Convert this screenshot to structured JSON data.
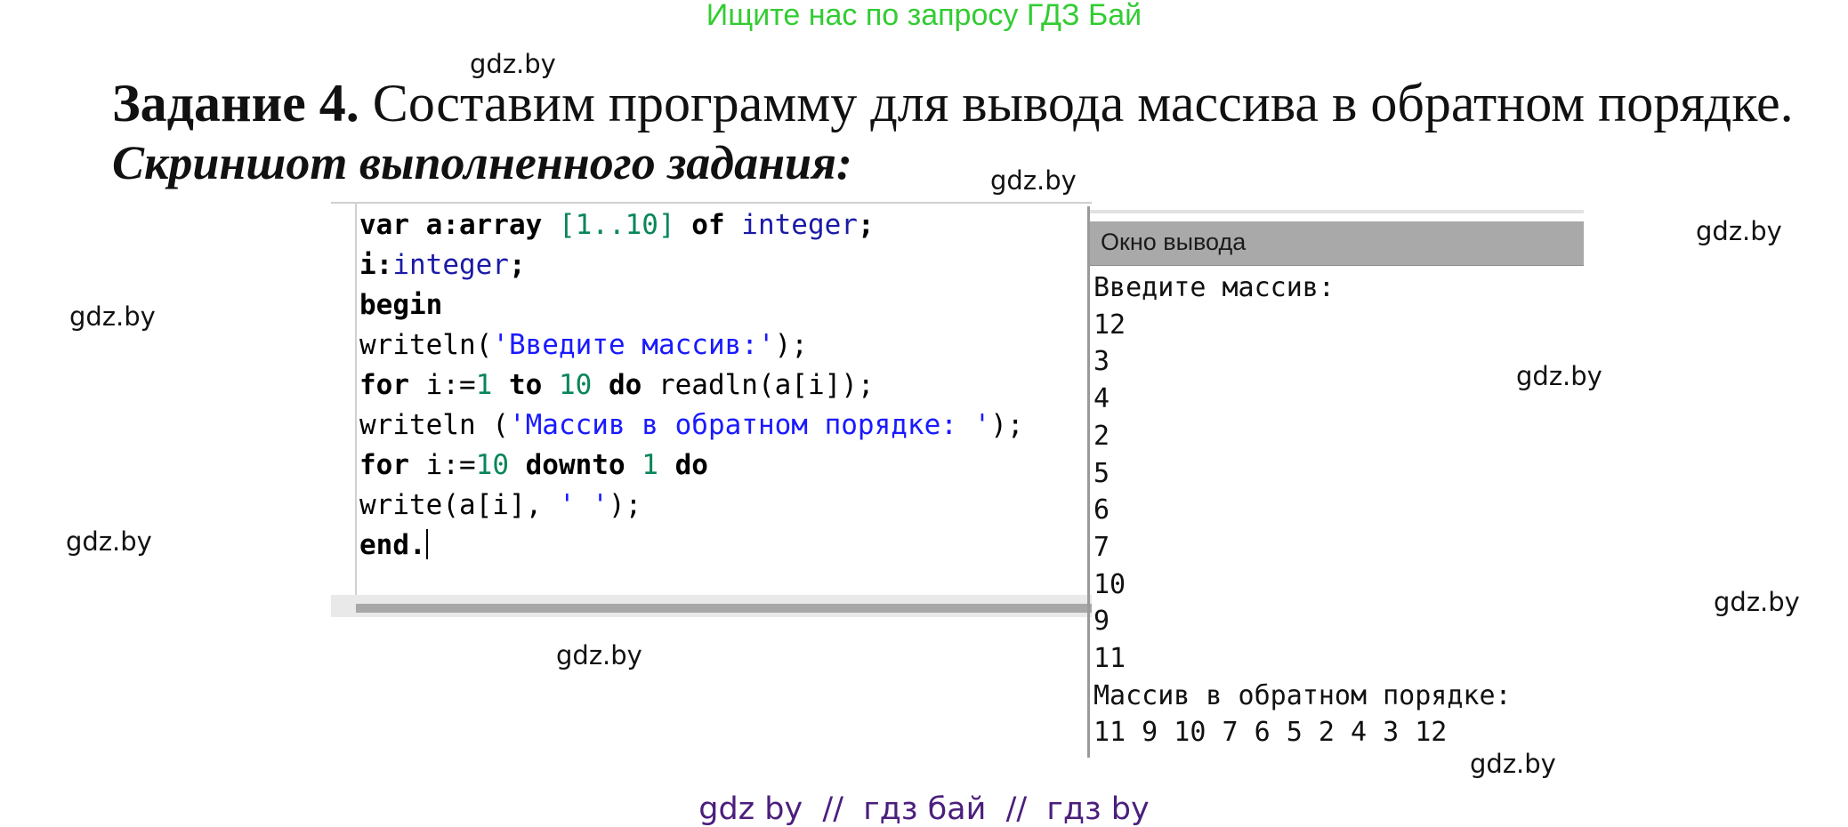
{
  "banner": "Ищите нас по запросу ГДЗ Бай",
  "watermark": "gdz.by",
  "task": {
    "label": "Задание 4.",
    "text": " Составим программу для вывода массива в обратном порядке.",
    "subtitle": "Скриншот выполненного задания:"
  },
  "editor": {
    "lines": [
      [
        {
          "t": "var a:",
          "c": "kw"
        },
        {
          "t": "array ",
          "c": "kw"
        },
        {
          "t": "[",
          "c": "nm"
        },
        {
          "t": "1",
          "c": "nm"
        },
        {
          "t": "..",
          "c": "nm"
        },
        {
          "t": "10",
          "c": "nm"
        },
        {
          "t": "] ",
          "c": "nm"
        },
        {
          "t": "of ",
          "c": "kw"
        },
        {
          "t": "integer",
          "c": "ty"
        },
        {
          "t": ";",
          "c": "kw"
        }
      ],
      [
        {
          "t": "i:",
          "c": "kw"
        },
        {
          "t": "integer",
          "c": "ty"
        },
        {
          "t": ";",
          "c": "kw"
        }
      ],
      [
        {
          "t": "begin",
          "c": "kw"
        }
      ],
      [
        {
          "t": "writeln(",
          "c": ""
        },
        {
          "t": "'Введите массив:'",
          "c": "st"
        },
        {
          "t": ");",
          "c": ""
        }
      ],
      [
        {
          "t": "for ",
          "c": "kw"
        },
        {
          "t": "i:=",
          "c": ""
        },
        {
          "t": "1",
          "c": "nm"
        },
        {
          "t": " to ",
          "c": "kw"
        },
        {
          "t": "10",
          "c": "nm"
        },
        {
          "t": " do ",
          "c": "kw"
        },
        {
          "t": "readln(a[i]);",
          "c": ""
        }
      ],
      [
        {
          "t": "writeln (",
          "c": ""
        },
        {
          "t": "'Массив в обратном порядке: '",
          "c": "st"
        },
        {
          "t": ");",
          "c": ""
        }
      ],
      [
        {
          "t": "for ",
          "c": "kw"
        },
        {
          "t": "i:=",
          "c": ""
        },
        {
          "t": "10",
          "c": "nm"
        },
        {
          "t": " downto ",
          "c": "kw"
        },
        {
          "t": "1",
          "c": "nm"
        },
        {
          "t": " do",
          "c": "kw"
        }
      ],
      [
        {
          "t": "write(a[i], ",
          "c": ""
        },
        {
          "t": "' '",
          "c": "st"
        },
        {
          "t": ");",
          "c": ""
        }
      ],
      [
        {
          "t": "end.",
          "c": "kw"
        }
      ]
    ]
  },
  "output": {
    "title": "Окно вывода",
    "lines": [
      "Введите массив:",
      "12",
      "3",
      "4",
      "2",
      "5",
      "6",
      "7",
      "10",
      "9",
      "11",
      "Массив в обратном порядке:",
      "11 9 10 7 6 5 2 4 3 12"
    ]
  },
  "footer": "gdz by  //  гдз бай  //  гдз by"
}
